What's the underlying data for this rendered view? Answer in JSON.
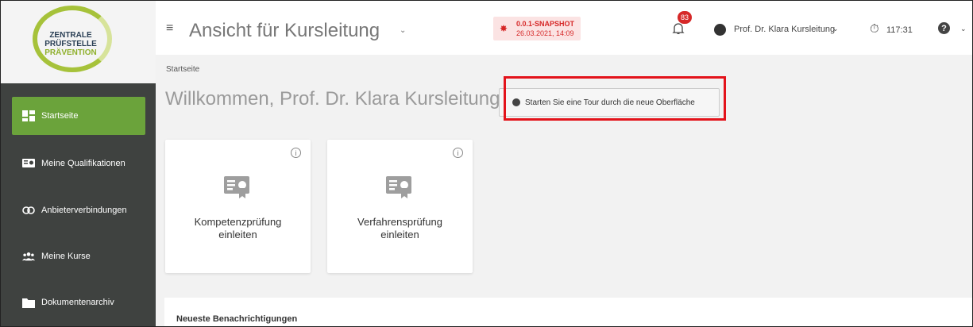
{
  "logo": {
    "line1": "ZENTRALE",
    "line2": "PRÜFSTELLE",
    "line3": "PRÄVENTION"
  },
  "sidebar": {
    "items": [
      {
        "label": "Startseite",
        "icon": "dashboard-icon",
        "active": true
      },
      {
        "label": "Meine Qualifikationen",
        "icon": "certificate-icon"
      },
      {
        "label": "Anbieterverbindungen",
        "icon": "link-icon"
      },
      {
        "label": "Meine Kurse",
        "icon": "group-icon"
      },
      {
        "label": "Dokumentenarchiv",
        "icon": "folder-icon"
      }
    ]
  },
  "header": {
    "view_title": "Ansicht für Kursleitung",
    "snapshot_version": "0.0.1-SNAPSHOT",
    "snapshot_date": "26.03.2021, 14:09",
    "notification_count": "83",
    "user_name": "Prof. Dr. Klara Kursleitung",
    "timer": "117:31"
  },
  "main": {
    "breadcrumb": "Startseite",
    "welcome": "Willkommen, Prof. Dr. Klara Kursleitung!",
    "tour_button": "Starten Sie eine Tour durch die neue Oberfläche",
    "cards": [
      {
        "title_line1": "Kompetenzprüfung",
        "title_line2": "einleiten"
      },
      {
        "title_line1": "Verfahrensprüfung",
        "title_line2": "einleiten"
      }
    ],
    "notifications_title": "Neueste Benachrichtigungen"
  },
  "colors": {
    "sidebar_bg": "#3f4240",
    "active_green": "#6ba33b",
    "highlight_red": "#e3131b",
    "badge_red": "#d62828"
  }
}
